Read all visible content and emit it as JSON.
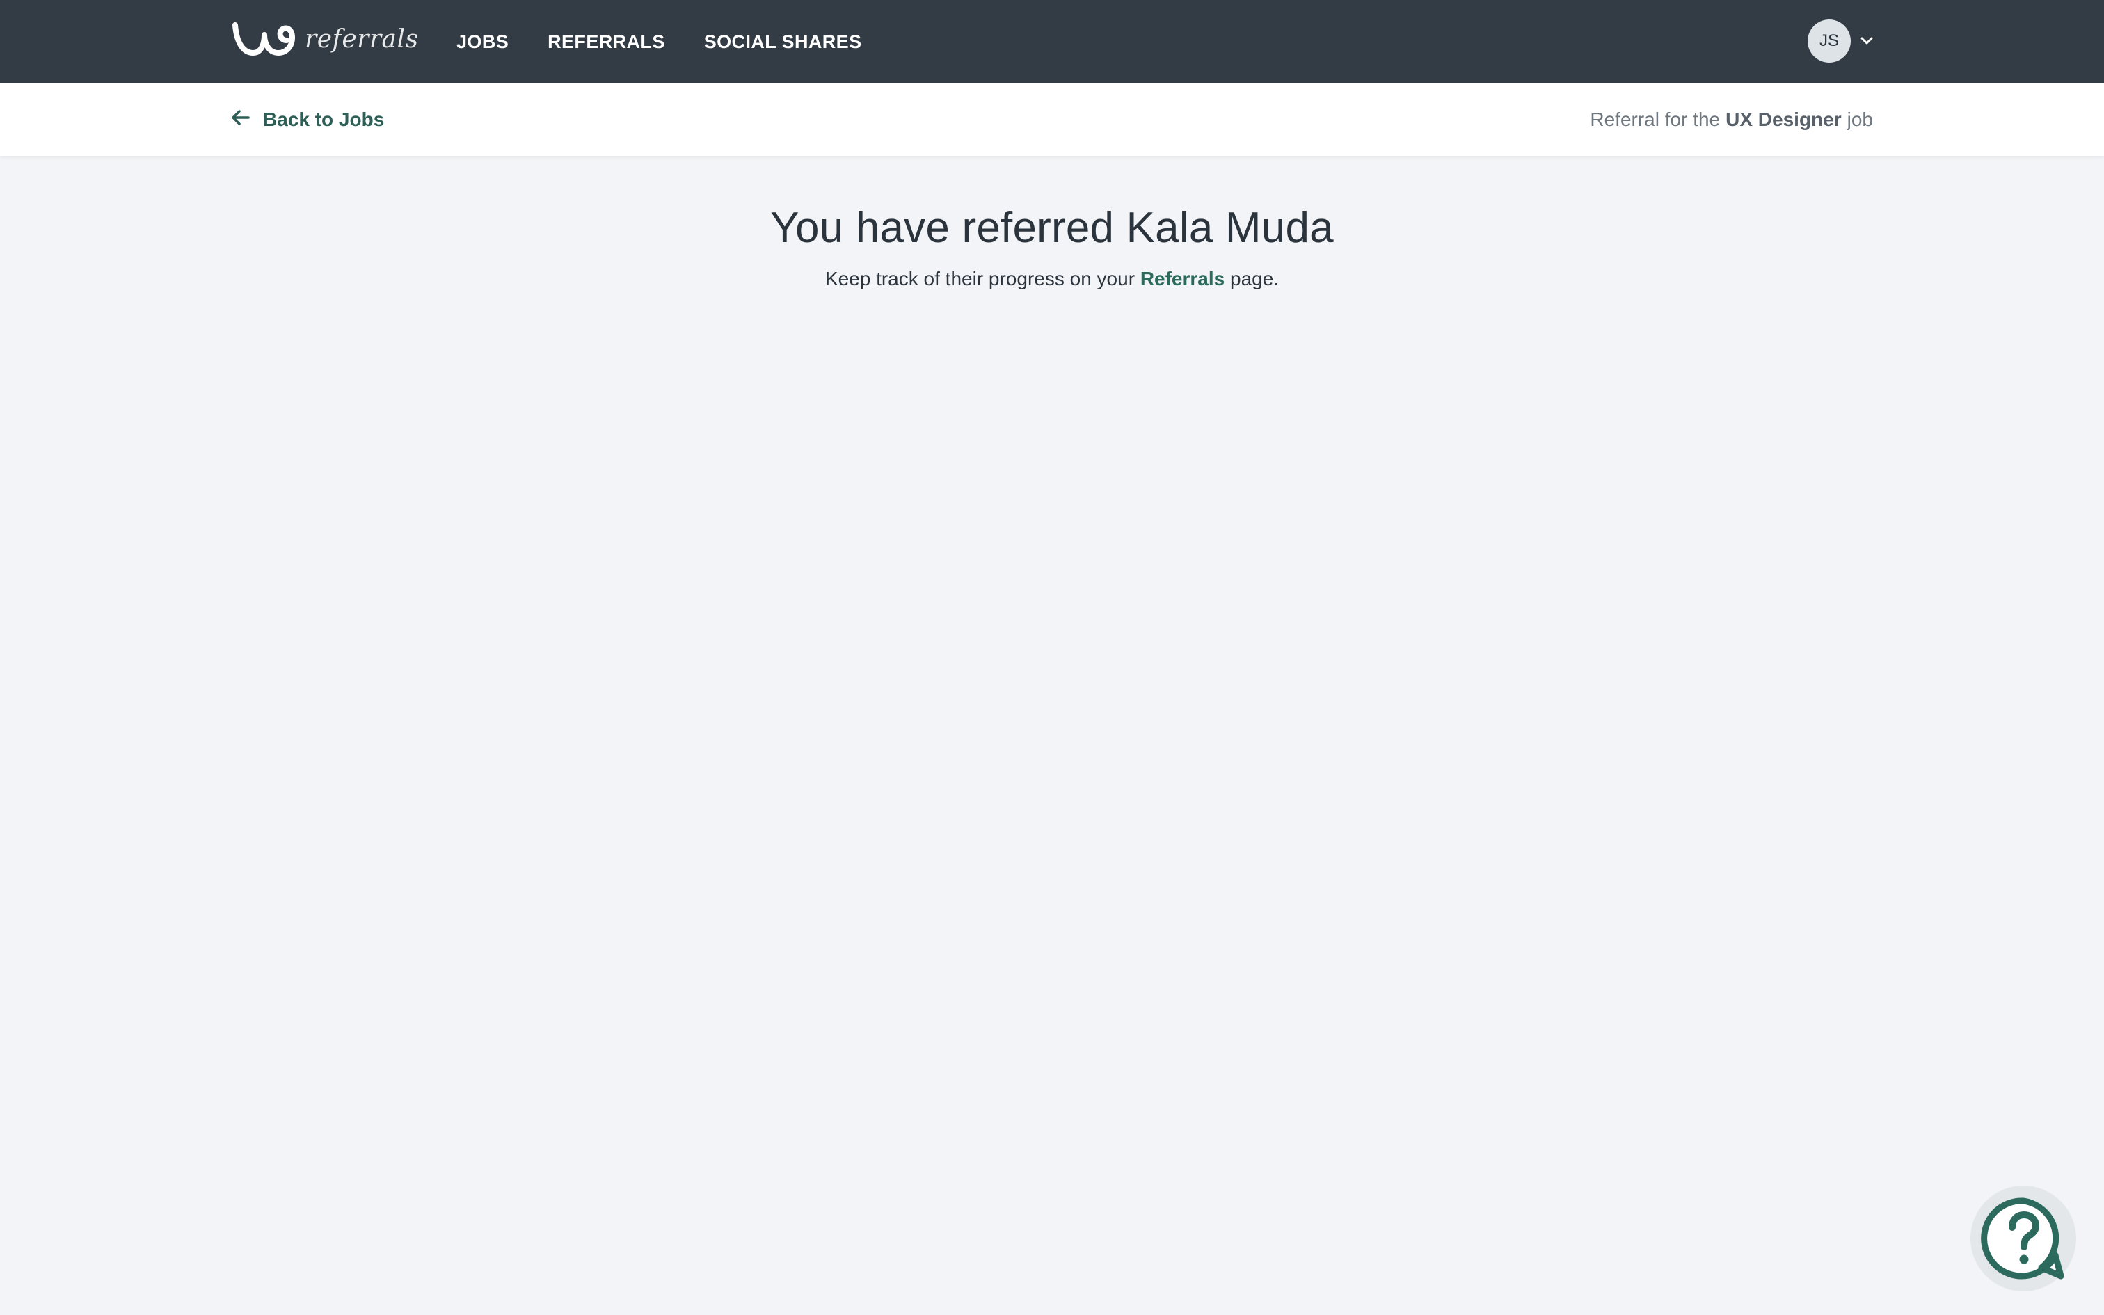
{
  "app": {
    "logo_text": "referrals"
  },
  "nav": {
    "items": [
      {
        "label": "JOBS"
      },
      {
        "label": "REFERRALS"
      },
      {
        "label": "SOCIAL SHARES"
      }
    ]
  },
  "user": {
    "initials": "JS"
  },
  "subheader": {
    "back_label": "Back to Jobs",
    "job_prefix": "Referral for the",
    "job_title": "UX Designer",
    "job_suffix": "job"
  },
  "main": {
    "title": "You have referred Kala Muda",
    "subtitle_pre": "Keep track of their progress on your",
    "subtitle_link": "Referrals",
    "subtitle_post": "page."
  },
  "colors": {
    "topbar": "#333b44",
    "accent": "#2d6a5e",
    "background": "#f3f4f7"
  },
  "icons": {
    "logo": "w-logo-icon",
    "back": "arrow-left-icon",
    "user_menu": "chevron-down-icon",
    "help": "help-question-icon"
  }
}
